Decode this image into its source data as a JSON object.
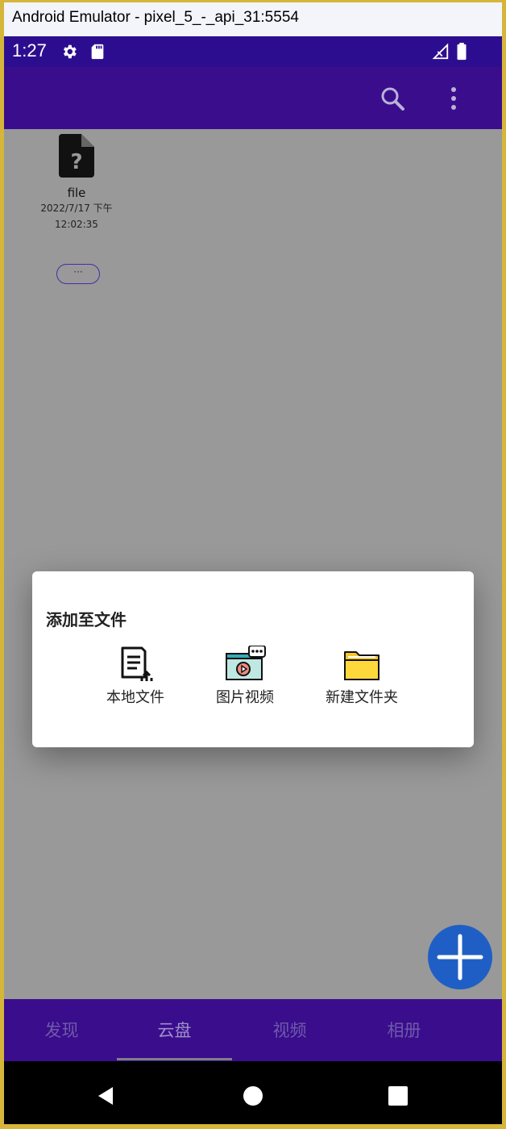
{
  "window": {
    "title": "Android Emulator - pixel_5_-_api_31:5554"
  },
  "status_bar": {
    "time": "1:27",
    "icons": [
      "settings-icon",
      "sd-card-icon",
      "signal-icon",
      "battery-icon"
    ]
  },
  "app_bar": {
    "icons": [
      "search-icon",
      "more-vert-icon"
    ]
  },
  "file": {
    "name": "file",
    "date": "2022/7/17 下午",
    "time": "12:02:35",
    "icon": "unknown-file-icon",
    "more_label": "···"
  },
  "dialog": {
    "title": "添加至文件",
    "options": [
      {
        "label": "本地文件",
        "icon": "local-file-upload-icon"
      },
      {
        "label": "图片视频",
        "icon": "photo-video-icon"
      },
      {
        "label": "新建文件夹",
        "icon": "new-folder-icon"
      }
    ]
  },
  "fab": {
    "icon": "plus-icon"
  },
  "bottom_nav": {
    "items": [
      {
        "label": "发现"
      },
      {
        "label": "云盘"
      },
      {
        "label": "视频"
      },
      {
        "label": "相册"
      }
    ],
    "active_index": 1
  },
  "system_nav": {
    "icons": [
      "back-icon",
      "home-icon",
      "recents-icon"
    ]
  },
  "colors": {
    "status_bar": "#2d0d8f",
    "app_bar": "#3a0d8d",
    "fab": "#1f5fc5",
    "scrim_background": "#999999"
  }
}
